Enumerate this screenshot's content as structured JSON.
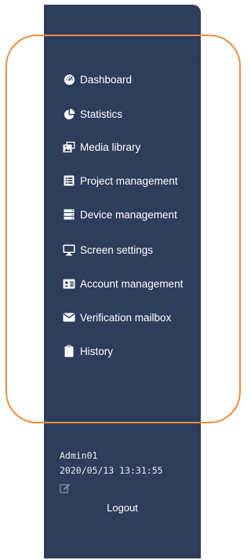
{
  "sidebar": {
    "background_color": "#2e3d5c",
    "items": [
      {
        "label": "Dashboard",
        "icon": "tachometer-icon"
      },
      {
        "label": "Statistics",
        "icon": "pie-chart-icon"
      },
      {
        "label": "Media library",
        "icon": "images-icon"
      },
      {
        "label": "Project management",
        "icon": "list-alt-icon"
      },
      {
        "label": "Device management",
        "icon": "server-icon"
      },
      {
        "label": "Screen settings",
        "icon": "desktop-icon"
      },
      {
        "label": "Account management",
        "icon": "id-card-icon"
      },
      {
        "label": "Verification mailbox",
        "icon": "envelope-icon"
      },
      {
        "label": "History",
        "icon": "clipboard-icon"
      }
    ]
  },
  "footer": {
    "username": "Admin01",
    "timestamp": "2020/05/13 13:31:55",
    "edit_icon": "edit-icon",
    "logout_label": "Logout"
  },
  "annotation": {
    "highlight_color": "#ee8a3c"
  }
}
